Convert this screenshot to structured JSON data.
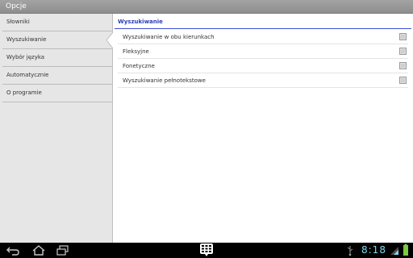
{
  "app": {
    "title": "Opcje"
  },
  "sidebar": {
    "items": [
      {
        "label": "Słowniki"
      },
      {
        "label": "Wyszukiwanie",
        "selected": true
      },
      {
        "label": "Wybór języka"
      },
      {
        "label": "Automatycznie"
      },
      {
        "label": "O programie"
      }
    ]
  },
  "main": {
    "section_title": "Wyszukiwanie",
    "options": [
      {
        "label": "Wyszukiwanie w obu kierunkach",
        "checked": false
      },
      {
        "label": "Fleksyjne",
        "checked": false
      },
      {
        "label": "Fonetyczne",
        "checked": false
      },
      {
        "label": "Wyszukiwanie pełnotekstowe",
        "checked": false
      }
    ]
  },
  "status_bar": {
    "time": "8:18",
    "icons": [
      "back-icon",
      "home-icon",
      "recent-apps-icon",
      "app-drawer-icon",
      "usb-icon",
      "wifi-icon",
      "battery-icon"
    ]
  },
  "colors": {
    "action_bar": "#9a9a9a",
    "sidebar_bg": "#e6e6e6",
    "accent": "#2c3fb8",
    "clock": "#7fd9f2"
  }
}
